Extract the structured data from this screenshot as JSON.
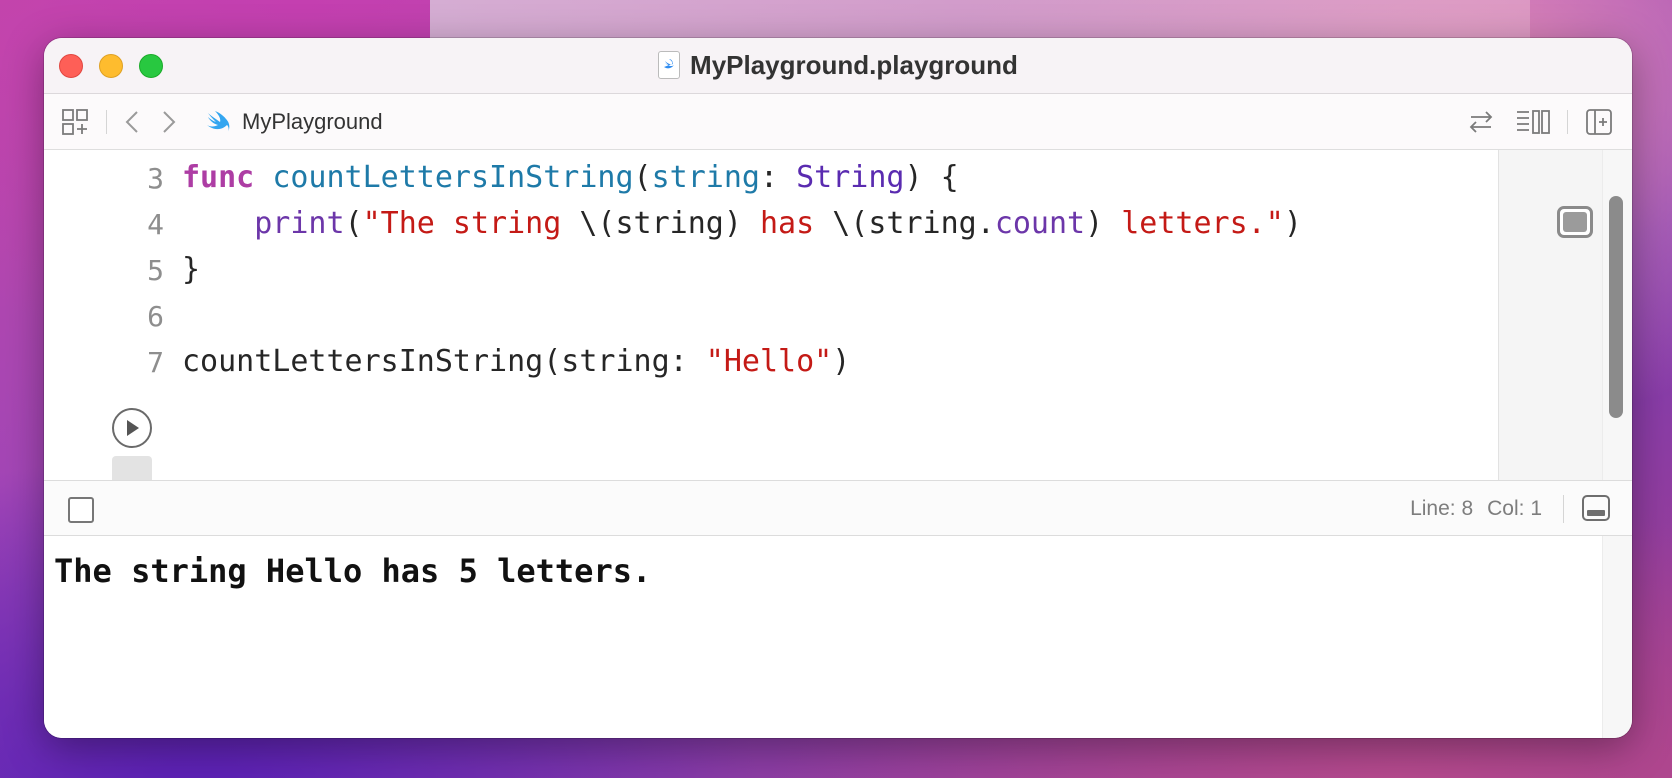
{
  "window": {
    "title": "MyPlayground.playground"
  },
  "toolbar": {
    "breadcrumb": "MyPlayground",
    "icons": [
      "grid-icon",
      "back-arrow-icon",
      "forward-arrow-icon",
      "swift-icon",
      "swap-icon",
      "inspector-list-icon",
      "add-panel-icon"
    ]
  },
  "editor": {
    "lines": [
      {
        "number": "3",
        "text": "func countLettersInString(string: String) {"
      },
      {
        "number": "4",
        "text": "    print(\"The string \\(string) has \\(string.count) letters.\")"
      },
      {
        "number": "5",
        "text": "}"
      },
      {
        "number": "6",
        "text": ""
      },
      {
        "number": "7",
        "text": "countLettersInString(string: \"Hello\")"
      }
    ],
    "tokens": {
      "l3_kw": "func",
      "l3_fn": "countLettersInString",
      "l3_paren_open": "(",
      "l3_param": "string",
      "l3_colon": ": ",
      "l3_type": "String",
      "l3_close": ") {",
      "l4_indent": "    ",
      "l4_print": "print",
      "l4_open": "(",
      "l4_str1": "\"The string ",
      "l4_interp1": "\\(string) ",
      "l4_str2": "has ",
      "l4_interp2a": "\\(string.",
      "l4_count": "count",
      "l4_interp2b": ") ",
      "l4_str3": "letters.\"",
      "l4_close": ")",
      "l5": "}",
      "l7_call": "countLettersInString(string: ",
      "l7_str": "\"Hello\"",
      "l7_close": ")"
    }
  },
  "status": {
    "line_label": "Line: 8",
    "col_label": "Col: 1"
  },
  "console": {
    "output": "The string Hello has 5 letters."
  },
  "colors": {
    "keyword": "#ad3da4",
    "function": "#1e7aa8",
    "type": "#5a2bb0",
    "string": "#c41a16",
    "close_button": "#fe5f57",
    "minimize_button": "#febc2e",
    "zoom_button": "#28c840"
  }
}
